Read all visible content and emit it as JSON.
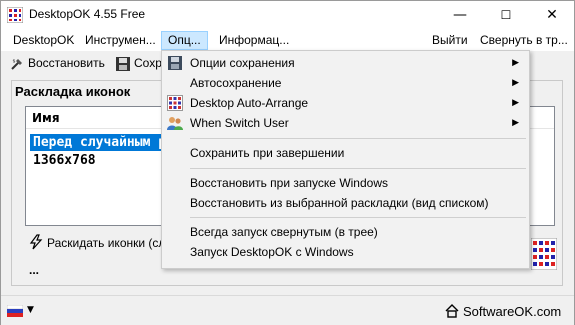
{
  "window": {
    "title": "DesktopOK 4.55 Free",
    "controls": {
      "minimize": "—",
      "maximize": "☐",
      "close": "✕"
    }
  },
  "menubar": {
    "items": [
      "DesktopOK",
      "Инструмен...",
      "Опц...",
      "Информац..."
    ],
    "right_items": [
      "Выйти",
      "Свернуть в тр..."
    ],
    "active_index": 2
  },
  "toolbar": {
    "restore_label": "Восстановить",
    "save_label": "Сохр"
  },
  "main": {
    "group_title": "Раскладка иконок",
    "column_header": "Имя",
    "rows": [
      "Перед случайным р",
      "1366x768"
    ],
    "selected_row": 0,
    "scatter_label": "Раскидать иконки (сл",
    "more_label": "..."
  },
  "status": {
    "site": "SoftwareOK.com",
    "chevron": "▼"
  },
  "dropdown": {
    "submenus": [
      {
        "label": "Опции сохранения",
        "icon": "floppy-icon"
      },
      {
        "label": "Автосохранение",
        "icon": "blank"
      },
      {
        "label": "Desktop Auto-Arrange",
        "icon": "grid-icon"
      },
      {
        "label": "When Switch User",
        "icon": "users-icon"
      }
    ],
    "save_on_exit": "Сохранить при завершении",
    "restore_group": [
      "Восстановить при запуске Windows",
      "Восстановить из выбранной раскладки (вид списком)"
    ],
    "startup_group": [
      "Всегда запуск свернутым (в трее)",
      "Запуск DesktopOK с Windows"
    ],
    "arrow": "▶"
  },
  "colors": {
    "selection": "#0078d7",
    "menu_active_bg": "#cce8ff",
    "window_bg": "#f0f0f0",
    "dropdown_bg": "#f2f2f2"
  }
}
